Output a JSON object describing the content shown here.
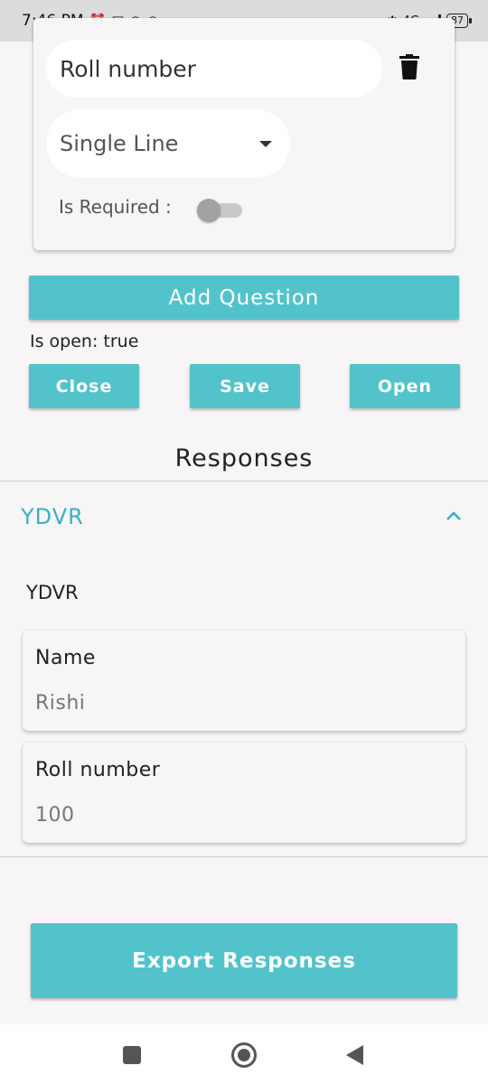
{
  "status_bar": {
    "time": "7:46 PM",
    "network": "4G",
    "battery": "87"
  },
  "question": {
    "title_value": "Roll number",
    "type_value": "Single Line",
    "required_label": "Is Required :",
    "required_on": false
  },
  "actions": {
    "add_question": "Add Question",
    "is_open_text": "Is open: true",
    "close": "Close",
    "save": "Save",
    "open": "Open"
  },
  "responses": {
    "title": "Responses",
    "group_title": "YDVR",
    "group_subtitle": "YDVR",
    "answers": [
      {
        "label": "Name",
        "value": "Rishi"
      },
      {
        "label": "Roll number",
        "value": "100"
      }
    ]
  },
  "export_button": "Export Responses",
  "colors": {
    "accent": "#53c3cb",
    "link": "#3bb0c4",
    "background": "#f7f5f6"
  }
}
